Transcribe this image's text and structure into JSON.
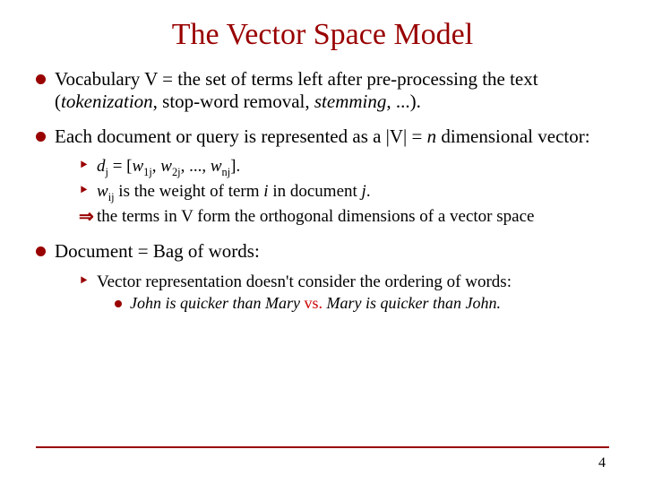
{
  "title": "The Vector Space Model",
  "bullets": {
    "vocab": {
      "pre": "Vocabulary V = the set of terms left after pre-processing the text (",
      "i1": "tokenization",
      "mid1": ", stop-word removal, ",
      "i2": "stemming",
      "post": ", ...)."
    },
    "eachdoc": {
      "pre": "Each document or query is represented as a |V| = ",
      "n": "n",
      "post": " dimensional vector:"
    },
    "dj": {
      "d": "d",
      "jsub": "j",
      "eq": " = [",
      "w": "w",
      "s1": "1j",
      "c1": ", ",
      "s2": "2j",
      "c2": ", ..., ",
      "sn": "nj",
      "end": "]."
    },
    "wij": {
      "w": "w",
      "ij": "ij",
      "mid1": " is the weight of term ",
      "i": "i",
      "mid2": " in document ",
      "j": "j",
      "end": "."
    },
    "ortho": "the terms in V form the orthogonal dimensions of a vector space",
    "bow": "Document = Bag of words:",
    "vecrep": "Vector representation doesn't consider the ordering of words:",
    "ex": {
      "a": "John is quicker than Mary",
      "vs": " vs. ",
      "b": "Mary is quicker than John",
      "dot": "."
    }
  },
  "marks": {
    "arrow": "‣",
    "implies": "⇒"
  },
  "page": "4"
}
